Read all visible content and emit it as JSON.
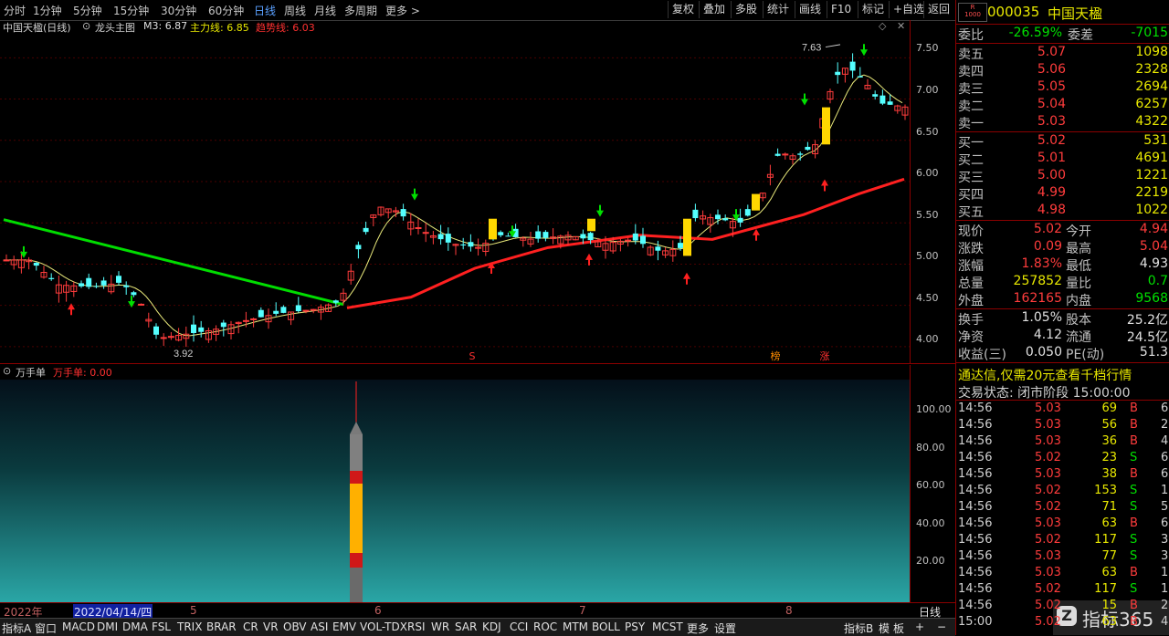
{
  "toolbar": {
    "periods": [
      "分时",
      "1分钟",
      "5分钟",
      "15分钟",
      "30分钟",
      "60分钟",
      "日线",
      "周线",
      "月线",
      "多周期",
      "更多 >"
    ],
    "active_period": "日线",
    "buttons": [
      "复权",
      "叠加",
      "多股",
      "统计",
      "画线",
      "F10",
      "标记",
      "+自选",
      "返回"
    ]
  },
  "main": {
    "title": "中国天楹(日线)",
    "indicator": "龙头主图",
    "m3": "M3: 6.87",
    "zhuli": "主力线: 6.85",
    "qushi": "趋势线: 6.03",
    "high_label": "7.63",
    "low_label": "3.92",
    "markers": [
      {
        "text": "S",
        "color": "#ff3030"
      },
      {
        "text": "榜",
        "color": "#ff8c00"
      },
      {
        "text": "涨",
        "color": "#ff3030"
      }
    ],
    "price_ticks": [
      "7.50",
      "7.00",
      "6.50",
      "6.00",
      "5.50",
      "5.00",
      "4.50",
      "4.00"
    ]
  },
  "sub": {
    "title": "万手单",
    "value": "万手单: 0.00",
    "ticks": [
      "100.00",
      "80.00",
      "60.00",
      "40.00",
      "20.00"
    ]
  },
  "datebar": {
    "labels": [
      "2022年",
      "2022/04/14/四",
      "5",
      "6",
      "7",
      "8"
    ],
    "period": "日线"
  },
  "indicators": [
    "指标A",
    "窗口",
    "MACD",
    "DMI",
    "DMA",
    "FSL",
    "TRIX",
    "BRAR",
    "CR",
    "VR",
    "OBV",
    "ASI",
    "EMV",
    "VOL-TDX",
    "RSI",
    "WR",
    "SAR",
    "KDJ",
    "CCI",
    "ROC",
    "MTM",
    "BOLL",
    "PSY",
    "MCST",
    "更多",
    "设置"
  ],
  "ind_right": [
    "指标B",
    "模",
    "板",
    "+",
    "−"
  ],
  "quote": {
    "code": "000035",
    "name": "中国天楹",
    "badge_top": "R",
    "badge_bot": "1000",
    "weibi_label": "委比",
    "weibi": "-26.59%",
    "weicha_label": "委差",
    "weicha": "-7015",
    "asks": [
      {
        "label": "卖五",
        "price": "5.07",
        "vol": "1098"
      },
      {
        "label": "卖四",
        "price": "5.06",
        "vol": "2328"
      },
      {
        "label": "卖三",
        "price": "5.05",
        "vol": "2694"
      },
      {
        "label": "卖二",
        "price": "5.04",
        "vol": "6257"
      },
      {
        "label": "卖一",
        "price": "5.03",
        "vol": "4322"
      }
    ],
    "bids": [
      {
        "label": "买一",
        "price": "5.02",
        "vol": "531"
      },
      {
        "label": "买二",
        "price": "5.01",
        "vol": "4691"
      },
      {
        "label": "买三",
        "price": "5.00",
        "vol": "1221"
      },
      {
        "label": "买四",
        "price": "4.99",
        "vol": "2219"
      },
      {
        "label": "买五",
        "price": "4.98",
        "vol": "1022"
      }
    ],
    "stats": [
      {
        "l1": "现价",
        "v1": "5.02",
        "c1": "red",
        "l2": "今开",
        "v2": "4.94",
        "c2": "red"
      },
      {
        "l1": "涨跌",
        "v1": "0.09",
        "c1": "red",
        "l2": "最高",
        "v2": "5.04",
        "c2": "red"
      },
      {
        "l1": "涨幅",
        "v1": "1.83%",
        "c1": "red",
        "l2": "最低",
        "v2": "4.93",
        "c2": "white"
      },
      {
        "l1": "总量",
        "v1": "257852",
        "c1": "yellow",
        "l2": "量比",
        "v2": "0.7",
        "c2": "green"
      },
      {
        "l1": "外盘",
        "v1": "162165",
        "c1": "red",
        "l2": "内盘",
        "v2": "9568",
        "c2": "green"
      }
    ],
    "fund": [
      {
        "l1": "换手",
        "v1": "1.05%",
        "l2": "股本",
        "v2": "25.2亿"
      },
      {
        "l1": "净资",
        "v1": "4.12",
        "l2": "流通",
        "v2": "24.5亿"
      },
      {
        "l1": "收益(三)",
        "v1": "0.050",
        "l2": "PE(动)",
        "v2": "51.3"
      }
    ],
    "promo": "通达信,仅需20元查看千档行情",
    "status": "交易状态: 闭市阶段 15:00:00"
  },
  "ticks": [
    {
      "t": "14:56",
      "p": "5.03",
      "v": "69",
      "s": "B",
      "n": "6"
    },
    {
      "t": "14:56",
      "p": "5.03",
      "v": "56",
      "s": "B",
      "n": "2"
    },
    {
      "t": "14:56",
      "p": "5.03",
      "v": "36",
      "s": "B",
      "n": "4"
    },
    {
      "t": "14:56",
      "p": "5.02",
      "v": "23",
      "s": "S",
      "n": "6"
    },
    {
      "t": "14:56",
      "p": "5.03",
      "v": "38",
      "s": "B",
      "n": "6"
    },
    {
      "t": "14:56",
      "p": "5.02",
      "v": "153",
      "s": "S",
      "n": "18"
    },
    {
      "t": "14:56",
      "p": "5.02",
      "v": "71",
      "s": "S",
      "n": "5"
    },
    {
      "t": "14:56",
      "p": "5.03",
      "v": "63",
      "s": "B",
      "n": "6"
    },
    {
      "t": "14:56",
      "p": "5.02",
      "v": "117",
      "s": "S",
      "n": "3"
    },
    {
      "t": "14:56",
      "p": "5.03",
      "v": "77",
      "s": "S",
      "n": "3"
    },
    {
      "t": "14:56",
      "p": "5.03",
      "v": "63",
      "s": "B",
      "n": "1"
    },
    {
      "t": "14:56",
      "p": "5.02",
      "v": "117",
      "s": "S",
      "n": "18"
    },
    {
      "t": "14:56",
      "p": "5.02",
      "v": "15",
      "s": "B",
      "n": "2"
    },
    {
      "t": "15:00",
      "p": "5.02",
      "v": "63",
      "s": "B",
      "n": "4"
    }
  ],
  "watermark": "指标365",
  "colors": {
    "up": "#ff3c3c",
    "down": "#54ffff",
    "ma_green": "#00dd00",
    "ma_red": "#ff2020",
    "ma_yellow": "#e8e87a",
    "grid": "#8b0000"
  }
}
